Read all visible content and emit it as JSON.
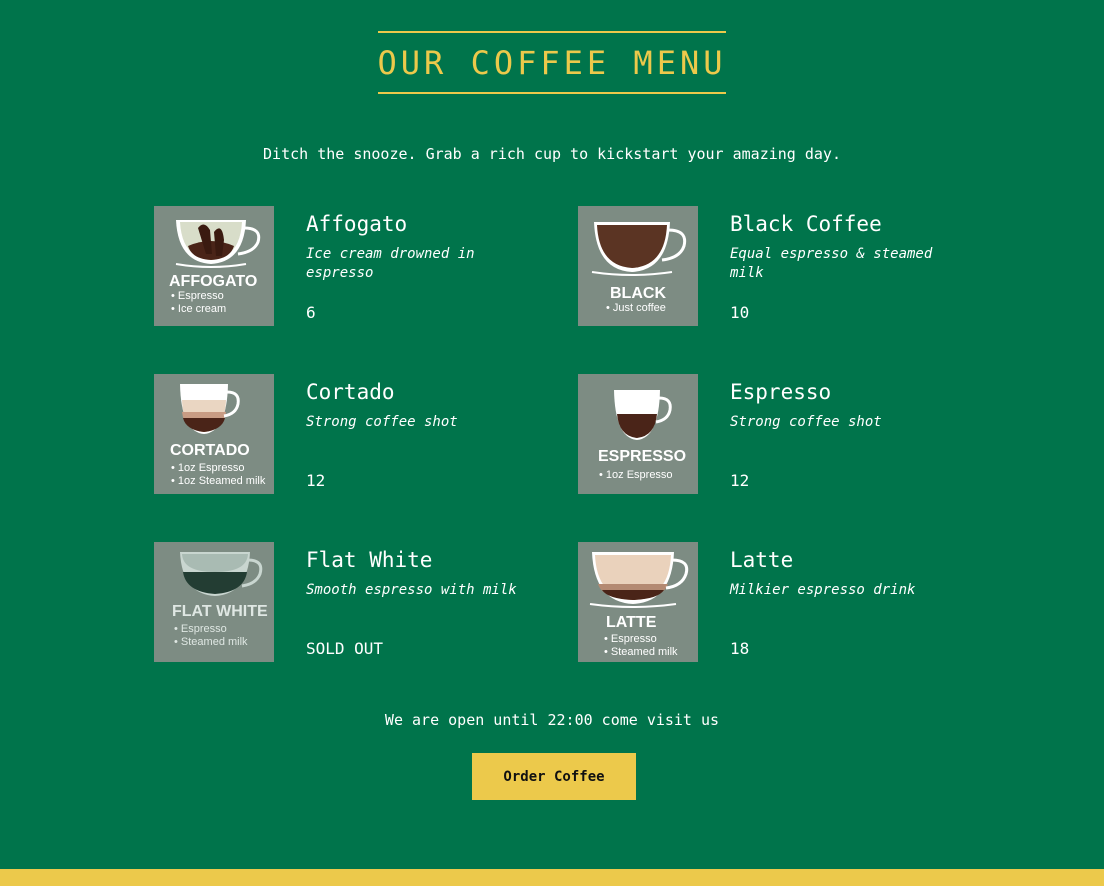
{
  "header": {
    "title": "OUR COFFEE MENU",
    "tagline": "Ditch the snooze. Grab a rich cup to kickstart your amazing day."
  },
  "colors": {
    "background": "#00744b",
    "accent": "#ecc94b",
    "thumb_bg": "#7d8c83"
  },
  "menu": [
    {
      "name": "Affogato",
      "description": "Ice cream drowned in espresso",
      "price": "6",
      "image": {
        "label": "AFFOGATO",
        "icon": "affogato-cup-icon",
        "lines": [
          "• Espresso",
          "• Ice cream"
        ]
      }
    },
    {
      "name": "Black Coffee",
      "description": "Equal espresso & steamed milk",
      "price": "10",
      "image": {
        "label": "BLACK",
        "icon": "black-coffee-cup-icon",
        "lines": [
          "• Just coffee"
        ]
      }
    },
    {
      "name": "Cortado",
      "description": "Strong coffee shot",
      "price": "12",
      "image": {
        "label": "CORTADO",
        "icon": "cortado-glass-icon",
        "lines": [
          "• 1oz Espresso",
          "• 1oz Steamed milk"
        ]
      }
    },
    {
      "name": "Espresso",
      "description": "Strong coffee shot",
      "price": "12",
      "image": {
        "label": "ESPRESSO",
        "icon": "espresso-cup-icon",
        "lines": [
          "• 1oz Espresso"
        ]
      }
    },
    {
      "name": "Flat White",
      "description": "Smooth espresso with milk",
      "price": "SOLD OUT",
      "image": {
        "label": "FLAT WHITE",
        "icon": "flat-white-cup-icon",
        "lines": [
          "• Espresso",
          "• Steamed milk"
        ]
      }
    },
    {
      "name": "Latte",
      "description": "Milkier espresso drink",
      "price": "18",
      "image": {
        "label": "LATTE",
        "icon": "latte-cup-icon",
        "lines": [
          "• Espresso",
          "• Steamed milk"
        ]
      }
    }
  ],
  "footer": {
    "hours_text": "We are open until 22:00 come visit us",
    "order_button": "Order Coffee"
  }
}
